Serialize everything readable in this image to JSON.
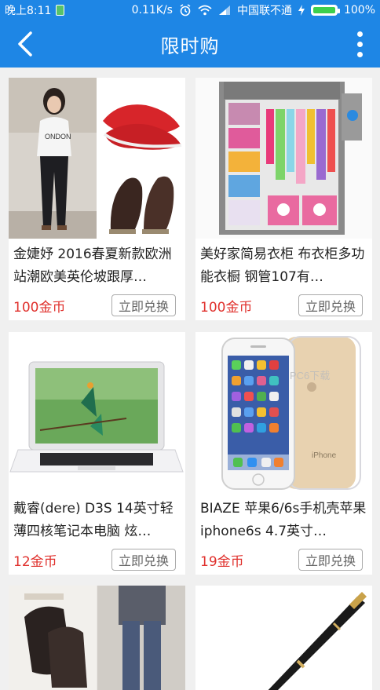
{
  "status_bar": {
    "time": "晚上8:11",
    "speed": "0.11K/s",
    "carrier": "中国联不通",
    "battery": "100%"
  },
  "app_bar": {
    "title": "限时购"
  },
  "products": [
    {
      "name": "金婕妤 2016春夏新款欧洲站潮欧美英伦坡跟厚…",
      "price": "100金币",
      "button": "立即兑换"
    },
    {
      "name": "美好家简易衣柜 布衣柜多功能衣橱 钢管107有…",
      "price": "100金币",
      "button": "立即兑换"
    },
    {
      "name": "戴睿(dere) D3S 14英寸轻薄四核笔记本电脑 炫…",
      "price": "12金币",
      "button": "立即兑换"
    },
    {
      "name": "BIAZE 苹果6/6s手机壳苹果iphone6s 4.7英寸…",
      "price": "19金币",
      "button": "立即兑换"
    },
    {
      "name": "",
      "price": "",
      "button": ""
    },
    {
      "name": "",
      "price": "",
      "button": ""
    }
  ],
  "watermark": "PC6下载"
}
